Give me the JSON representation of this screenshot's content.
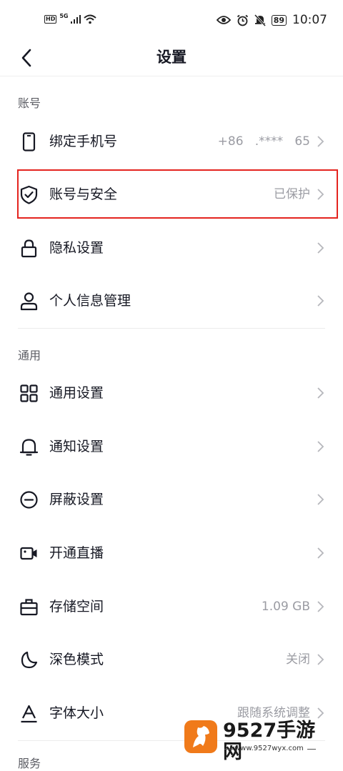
{
  "status_bar": {
    "hd": "HD",
    "network": "5G",
    "battery": "89",
    "time": "10:07"
  },
  "nav": {
    "title": "设置"
  },
  "sections": {
    "account": "账号",
    "general": "通用",
    "next": "服务"
  },
  "rows": {
    "phone": {
      "label": "绑定手机号",
      "value": "+86   .****   65",
      "icon": "phone-icon"
    },
    "security": {
      "label": "账号与安全",
      "value": "已保护",
      "icon": "shield-check-icon"
    },
    "privacy": {
      "label": "隐私设置",
      "value": "",
      "icon": "lock-icon"
    },
    "personal_info": {
      "label": "个人信息管理",
      "value": "",
      "icon": "person-icon"
    },
    "general_settings": {
      "label": "通用设置",
      "value": "",
      "icon": "grid-icon"
    },
    "notifications": {
      "label": "通知设置",
      "value": "",
      "icon": "bell-icon"
    },
    "block": {
      "label": "屏蔽设置",
      "value": "",
      "icon": "minus-circle-icon"
    },
    "live": {
      "label": "开通直播",
      "value": "",
      "icon": "video-camera-icon"
    },
    "storage": {
      "label": "存储空间",
      "value": "1.09 GB",
      "icon": "briefcase-icon"
    },
    "dark_mode": {
      "label": "深色模式",
      "value": "关闭",
      "icon": "moon-icon"
    },
    "font_size": {
      "label": "字体大小",
      "value": "跟随系统调整",
      "icon": "font-icon"
    }
  },
  "watermark": {
    "title": "9527手游网",
    "url": "www.9527wyx.com"
  },
  "colors": {
    "highlight": "#e4241f",
    "accent_watermark": "#f07a1a"
  }
}
